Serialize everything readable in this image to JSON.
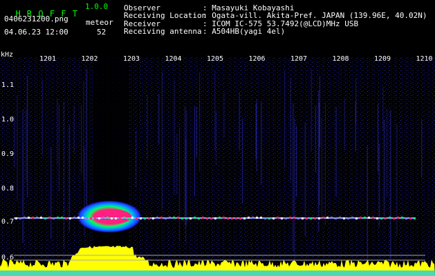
{
  "header": {
    "app_name": "H R O F F T",
    "version": "1.0.0",
    "filename": "0406231200.png",
    "datetime": "04.06.23 12:00",
    "meteor_label": "meteor",
    "meteor_count": "52"
  },
  "info": [
    {
      "key": "Observer",
      "value": ": Masayuki Kobayashi"
    },
    {
      "key": "Receiving Location",
      "value": ": Ogata-vill. Akita-Pref. JAPAN (139.96E, 40.02N)"
    },
    {
      "key": "Receiver",
      "value": ": ICOM IC-575 53.7492(@LCD)MHz USB"
    },
    {
      "key": "Receiving antenna",
      "value": ": A504HB(yagi 4el)"
    }
  ],
  "axis": {
    "y_unit": "kHz",
    "y_ticks": [
      "1.1",
      "1.0",
      "0.9",
      "0.8",
      "0.7",
      "0.6"
    ],
    "x_ticks": [
      "1201",
      "1202",
      "1203",
      "1204",
      "1205",
      "1206",
      "1207",
      "1208",
      "1209",
      "1210"
    ]
  },
  "colors": {
    "background": "#000000",
    "noise": "#1a1aa0",
    "signal": "#ff3070",
    "power": "#ffff00",
    "text_green": "#00ff00"
  }
}
